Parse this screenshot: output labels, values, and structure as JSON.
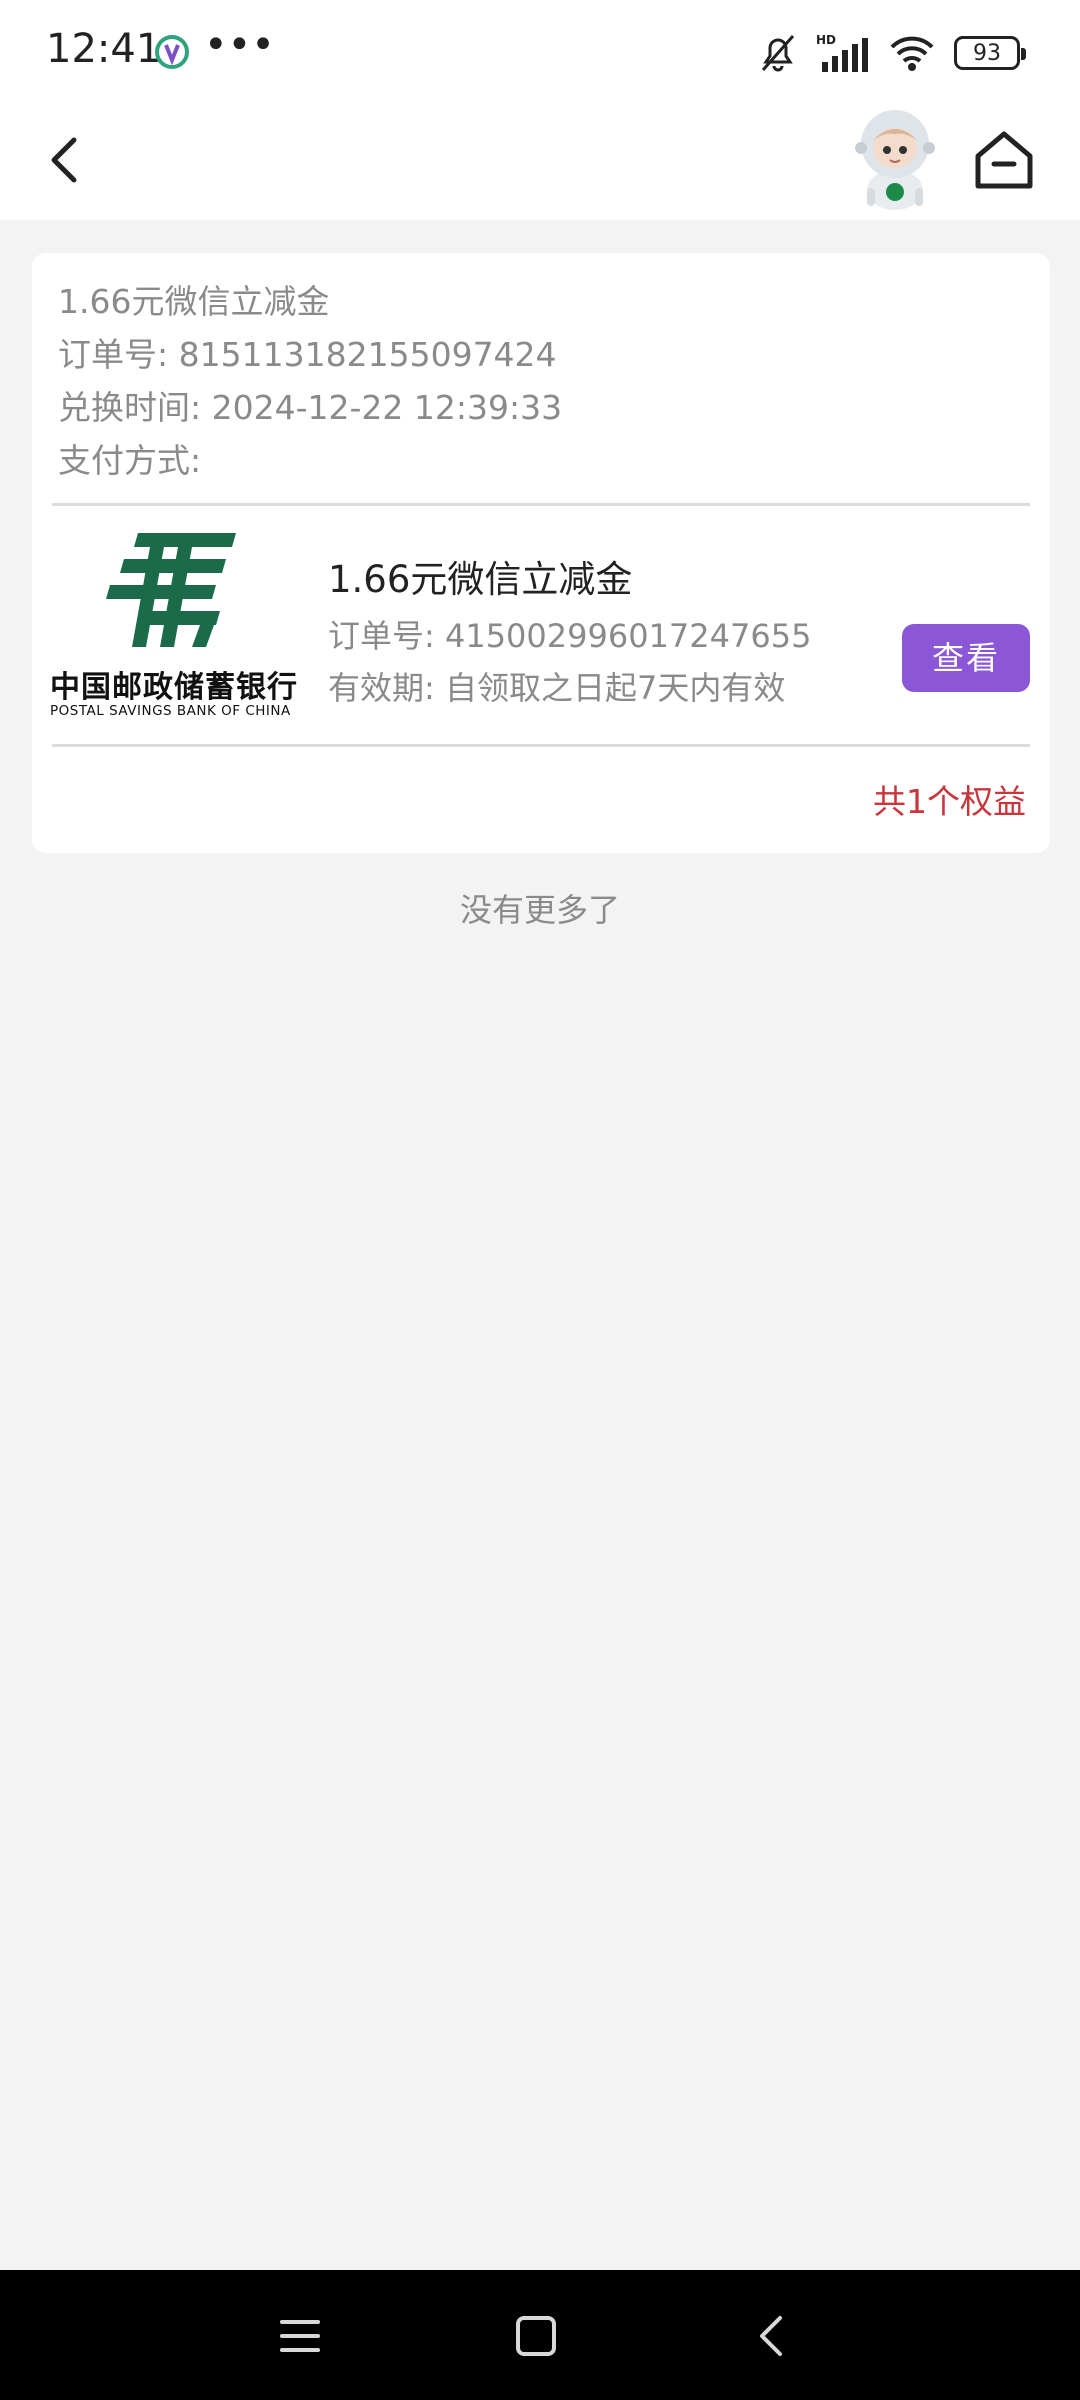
{
  "status_bar": {
    "time": "12:41",
    "app_icon": "app-notification-icon",
    "more_dots": "•••",
    "icons": [
      "bell-muted-icon",
      "hd-signal-icon",
      "wifi-icon",
      "battery-icon"
    ],
    "battery_level": "93"
  },
  "nav": {
    "back_icon": "chevron-left-icon",
    "mascot": "astronaut-mascot",
    "home_icon": "home-icon"
  },
  "order": {
    "title": "1.66元微信立减金",
    "order_no_label": "订单号:",
    "order_no": "815113182155097424",
    "time_label": "兑换时间:",
    "time": "2024-12-22 12:39:33",
    "pay_label": "支付方式:",
    "pay_value": ""
  },
  "item": {
    "logo_cn": "中国邮政储蓄银行",
    "logo_en": "POSTAL SAVINGS BANK OF CHINA",
    "title": "1.66元微信立减金",
    "order_no_label": "订单号:",
    "order_no": "415002996017247655",
    "validity_label": "有效期:",
    "validity": "自领取之日起7天内有效",
    "view_button": "查看"
  },
  "summary": {
    "total": "共1个权益"
  },
  "footer": {
    "no_more": "没有更多了"
  },
  "colors": {
    "accent_purple": "#8b57d6",
    "total_red": "#c8363c",
    "logo_green": "#1b6b4a"
  },
  "system_nav": [
    "menu-icon",
    "home-square-icon",
    "back-icon"
  ]
}
